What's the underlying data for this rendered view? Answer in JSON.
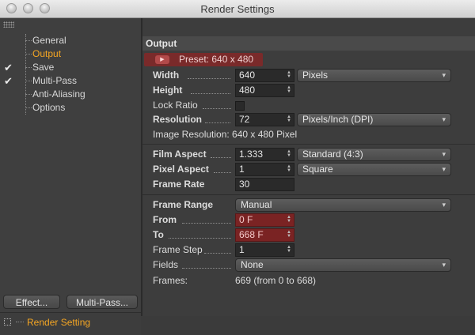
{
  "window": {
    "title": "Render Settings"
  },
  "sidebar": {
    "items": [
      {
        "label": "General",
        "checked": false,
        "active": false
      },
      {
        "label": "Output",
        "checked": false,
        "active": true
      },
      {
        "label": "Save",
        "checked": true,
        "active": false
      },
      {
        "label": "Multi-Pass",
        "checked": true,
        "active": false
      },
      {
        "label": "Anti-Aliasing",
        "checked": false,
        "active": false
      },
      {
        "label": "Options",
        "checked": false,
        "active": false
      }
    ],
    "checkmark": "✔",
    "effect_button": "Effect...",
    "multipass_button": "Multi-Pass...",
    "render_setting_label": "Render Setting"
  },
  "output": {
    "section_title": "Output",
    "preset_label": "Preset: 640 x 480",
    "width": {
      "label": "Width",
      "value": "640",
      "unit": "Pixels"
    },
    "height": {
      "label": "Height",
      "value": "480"
    },
    "lock_ratio": {
      "label": "Lock Ratio",
      "checked": false
    },
    "resolution": {
      "label": "Resolution",
      "value": "72",
      "unit": "Pixels/Inch (DPI)"
    },
    "image_resolution": "Image Resolution: 640 x 480 Pixel",
    "film_aspect": {
      "label": "Film Aspect",
      "value": "1.333",
      "option": "Standard (4:3)"
    },
    "pixel_aspect": {
      "label": "Pixel Aspect",
      "value": "1",
      "option": "Square"
    },
    "frame_rate": {
      "label": "Frame Rate",
      "value": "30"
    },
    "frame_range": {
      "label": "Frame Range",
      "option": "Manual"
    },
    "from": {
      "label": "From",
      "value": "0 F"
    },
    "to": {
      "label": "To",
      "value": "668 F"
    },
    "frame_step": {
      "label": "Frame Step",
      "value": "1"
    },
    "fields": {
      "label": "Fields",
      "option": "None"
    },
    "frames": {
      "label": "Frames:",
      "value": "669 (from 0 to 668)"
    }
  },
  "icons": {
    "spinner": "spinner-arrows-icon",
    "dropdown": "chevron-updown-icon",
    "preset": "play-icon",
    "render_setting": "render-setting-icon",
    "grip": "grip-icon"
  },
  "colors": {
    "accent": "#f5a623",
    "highlight_red": "#7a2323"
  }
}
